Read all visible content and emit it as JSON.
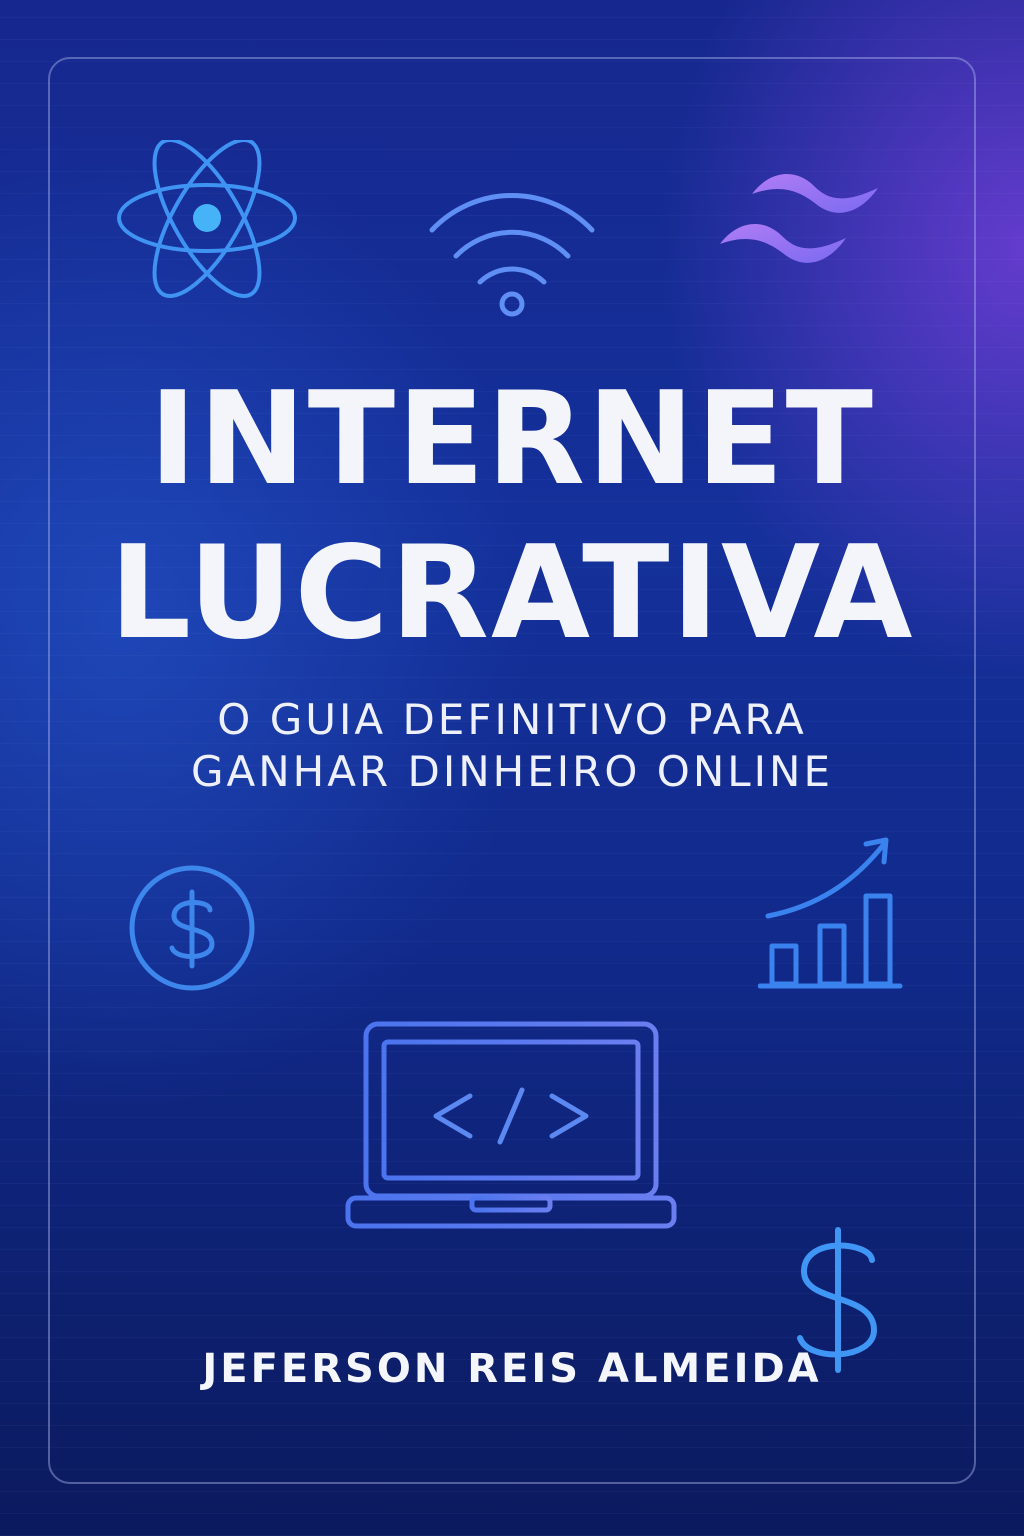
{
  "cover": {
    "title_line1": "INTERNET",
    "title_line2": "LUCRATIVA",
    "subtitle_line1": "O GUIA DEFINITIVO PARA",
    "subtitle_line2": "GANHAR DINHEIRO ONLINE",
    "author": "JEFERSON REIS ALMEIDA"
  },
  "icons": [
    "react-atom-icon",
    "wifi-icon",
    "tailwind-wave-icon",
    "dollar-coin-icon",
    "growth-chart-icon",
    "laptop-code-icon",
    "dollar-sign-icon"
  ],
  "colors": {
    "background_top": "#16288f",
    "background_bottom": "#0b1a5e",
    "accent_purple": "#8e44ec",
    "icon_blue": "#3d8ff0",
    "icon_violet": "#8f7bf2",
    "text": "#f3f5fb"
  }
}
